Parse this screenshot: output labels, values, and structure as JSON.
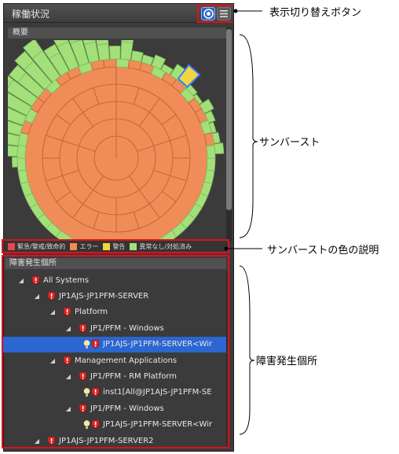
{
  "panel": {
    "title": "稼働状況",
    "overview_header": "概要",
    "faults_header": "障害発生個所"
  },
  "legend": [
    {
      "label": "緊急/警戒/致命的",
      "color": "#e8474c"
    },
    {
      "label": "エラー",
      "color": "#ef8c57"
    },
    {
      "label": "警告",
      "color": "#f2d541"
    },
    {
      "label": "異常なし/対処済み",
      "color": "#a3e07a"
    }
  ],
  "tree": [
    {
      "label": "All Systems",
      "level": 0,
      "icon": "alert-icon"
    },
    {
      "label": "JP1AJS-JP1PFM-SERVER",
      "level": 1,
      "icon": "alert-icon"
    },
    {
      "label": "Platform",
      "level": 2,
      "icon": "alert-icon"
    },
    {
      "label": "JP1/PFM - Windows",
      "level": 3,
      "icon": "alert-icon"
    },
    {
      "label": "JP1AJS-JP1PFM-SERVER<Wir",
      "level": 4,
      "icon": "bulb-alert-icon",
      "selected": true
    },
    {
      "label": "Management Applications",
      "level": 2,
      "icon": "alert-icon"
    },
    {
      "label": "JP1/PFM - RM Platform",
      "level": 3,
      "icon": "alert-icon"
    },
    {
      "label": "inst1[All@JP1AJS-JP1PFM-SE",
      "level": 4,
      "icon": "bulb-alert-icon"
    },
    {
      "label": "JP1/PFM - Windows",
      "level": 3,
      "icon": "alert-icon"
    },
    {
      "label": "JP1AJS-JP1PFM-SERVER<Wir",
      "level": 4,
      "icon": "bulb-alert-icon"
    },
    {
      "label": "JP1AJS-JP1PFM-SERVER2",
      "level": 1,
      "icon": "alert-icon"
    }
  ],
  "callouts": {
    "toggle": "表示切り替えボタン",
    "sunburst": "サンバースト",
    "legend": "サンバーストの色の説明",
    "faults": "障害発生個所"
  },
  "colors": {
    "error": "#ef8c57",
    "ok": "#a3e07a",
    "warning": "#f2d541",
    "accent": "#2b66d1",
    "callout_box": "#e0101a"
  }
}
